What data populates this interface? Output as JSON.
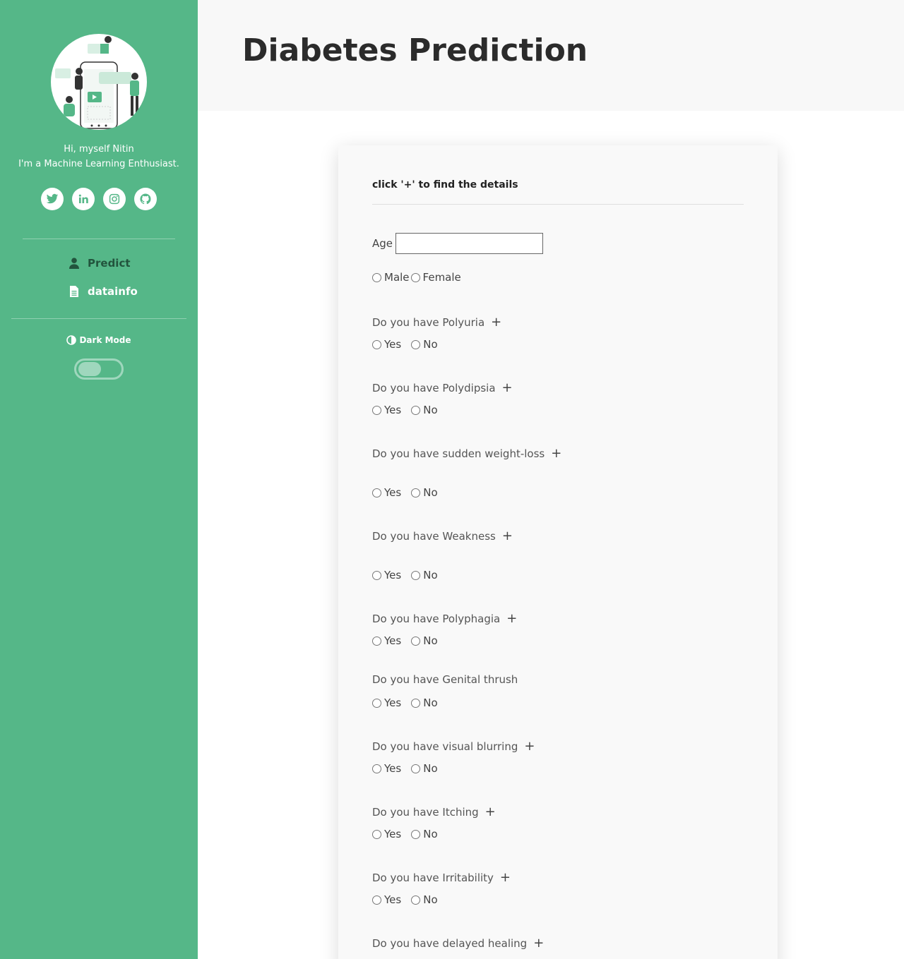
{
  "sidebar": {
    "greeting": "Hi, myself Nitin",
    "tagline": "I'm a Machine Learning Enthusiast.",
    "socials": [
      "twitter-icon",
      "linkedin-icon",
      "instagram-icon",
      "github-icon"
    ],
    "nav": {
      "predict": "Predict",
      "datainfo": "datainfo"
    },
    "dark_mode_label": "Dark Mode",
    "dark_mode_on": false,
    "colors": {
      "background": "#55b788",
      "active_nav": "#22543d"
    }
  },
  "header": {
    "title": "Diabetes Prediction"
  },
  "form": {
    "hint": "click '+' to find the details",
    "age_label": "Age",
    "age_value": "",
    "gender_options": [
      "Male",
      "Female"
    ],
    "yes_label": "Yes",
    "no_label": "No",
    "plus_symbol": "+",
    "questions": [
      "Do you have Polyuria",
      "Do you have Polydipsia",
      "Do you have sudden weight-loss",
      "Do you have Weakness",
      "Do you have Polyphagia",
      "Do you have Genital thrush",
      "Do you have visual blurring",
      "Do you have Itching",
      "Do you have Irritability",
      "Do you have delayed healing"
    ]
  }
}
